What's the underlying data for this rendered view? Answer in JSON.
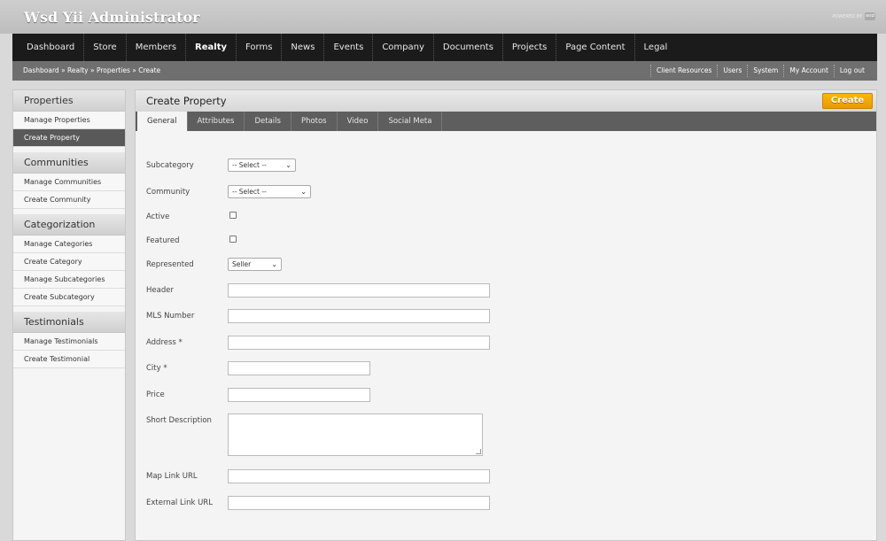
{
  "header": {
    "app_title": "Wsd Yii Administrator",
    "powered_by": "POWERED BY",
    "powered_logo": "wsd"
  },
  "main_nav": {
    "items": [
      {
        "label": "Dashboard"
      },
      {
        "label": "Store"
      },
      {
        "label": "Members"
      },
      {
        "label": "Realty",
        "active": true
      },
      {
        "label": "Forms"
      },
      {
        "label": "News"
      },
      {
        "label": "Events"
      },
      {
        "label": "Company"
      },
      {
        "label": "Documents"
      },
      {
        "label": "Projects"
      },
      {
        "label": "Page Content"
      },
      {
        "label": "Legal"
      }
    ]
  },
  "subbar": {
    "breadcrumb": "Dashboard » Realty » Properties » Create",
    "links": [
      "Client Resources",
      "Users",
      "System",
      "My Account",
      "Log out"
    ]
  },
  "sidebar": {
    "sections": [
      {
        "title": "Properties",
        "items": [
          {
            "label": "Manage Properties"
          },
          {
            "label": "Create Property",
            "active": true
          }
        ]
      },
      {
        "title": "Communities",
        "items": [
          {
            "label": "Manage Communities"
          },
          {
            "label": "Create Community"
          }
        ]
      },
      {
        "title": "Categorization",
        "items": [
          {
            "label": "Manage Categories"
          },
          {
            "label": "Create Category"
          },
          {
            "label": "Manage Subcategories"
          },
          {
            "label": "Create Subcategory"
          }
        ]
      },
      {
        "title": "Testimonials",
        "items": [
          {
            "label": "Manage Testimonials"
          },
          {
            "label": "Create Testimonial"
          }
        ]
      }
    ]
  },
  "content": {
    "title": "Create Property",
    "create_button": "Create",
    "tabs": [
      {
        "label": "General",
        "active": true
      },
      {
        "label": "Attributes"
      },
      {
        "label": "Details"
      },
      {
        "label": "Photos"
      },
      {
        "label": "Video"
      },
      {
        "label": "Social Meta"
      }
    ],
    "form": {
      "subcategory": {
        "label": "Subcategory",
        "value": "-- Select --"
      },
      "community": {
        "label": "Community",
        "value": "-- Select --"
      },
      "active": {
        "label": "Active",
        "checked": false
      },
      "featured": {
        "label": "Featured",
        "checked": false
      },
      "represented": {
        "label": "Represented",
        "value": "Seller"
      },
      "header": {
        "label": "Header",
        "value": ""
      },
      "mls_number": {
        "label": "MLS Number",
        "value": ""
      },
      "address": {
        "label": "Address *",
        "value": ""
      },
      "city": {
        "label": "City *",
        "value": ""
      },
      "price": {
        "label": "Price",
        "value": ""
      },
      "short_description": {
        "label": "Short Description",
        "value": ""
      },
      "map_link_url": {
        "label": "Map Link URL",
        "value": ""
      },
      "external_link_url": {
        "label": "External Link URL",
        "value": ""
      }
    }
  },
  "colors": {
    "accent": "#f5a800",
    "nav_bg": "#1b1b1b",
    "subbar_bg": "#6f6f6f",
    "tab_bg": "#5e5e5e",
    "active_side_item": "#595959"
  }
}
